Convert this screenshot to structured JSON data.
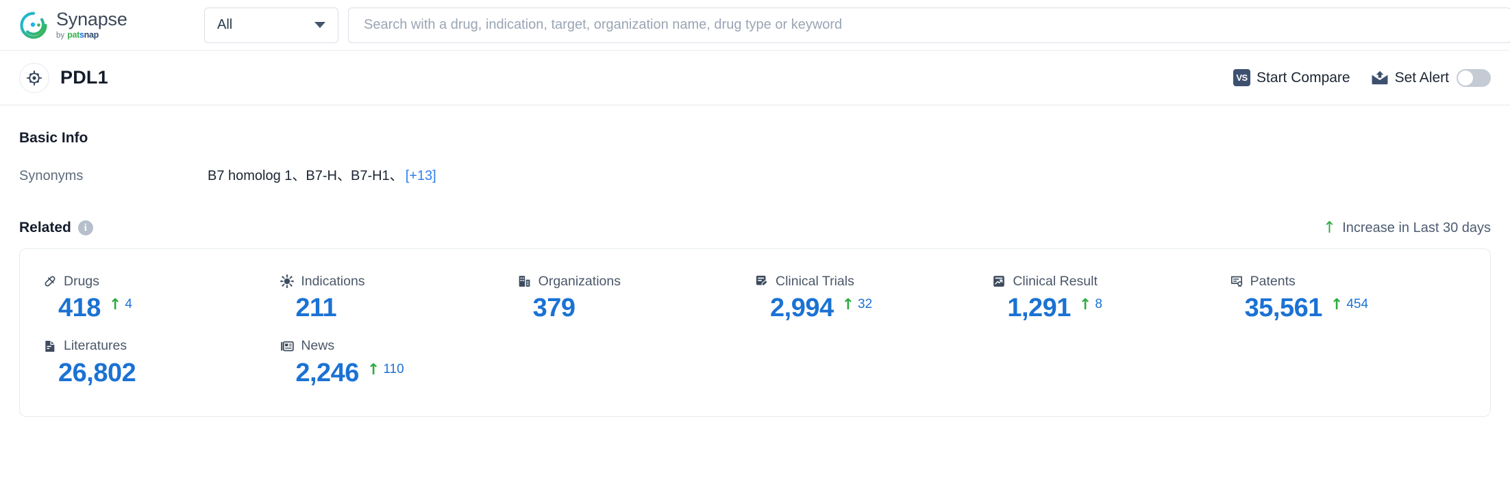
{
  "brand": {
    "name": "Synapse",
    "by": "by",
    "patsnap_pat": "pat",
    "patsnap_s": "s",
    "patsnap_nap": "nap",
    "logo_icon": "synapse-logo-icon",
    "colors": {
      "green": "#38b24a",
      "blue": "#1a73e8",
      "dark": "#2f4b6e"
    }
  },
  "search": {
    "scope_label": "All",
    "scope_icon": "chevron-down-icon",
    "placeholder": "Search with a drug, indication, target, organization name, drug type or keyword",
    "value": ""
  },
  "entity": {
    "icon": "target-icon",
    "title": "PDL1",
    "actions": {
      "compare_label": "Start Compare",
      "compare_icon": "vs-icon",
      "alert_label": "Set Alert",
      "alert_icon": "mail-alert-icon",
      "alert_toggle_on": false
    }
  },
  "basic_info": {
    "heading": "Basic Info",
    "synonyms_label": "Synonyms",
    "synonyms_value": "B7 homolog 1、B7-H、B7-H1、",
    "synonyms_more": "[+13]"
  },
  "related": {
    "heading": "Related",
    "info_icon": "info-icon",
    "info_glyph": "i",
    "legend_icon": "arrow-up-icon",
    "legend_arrow": "↑",
    "legend_text": "Increase in Last 30 days",
    "accent_blue": "#1b72d4",
    "accent_green": "#2cab3f",
    "stats": [
      {
        "label": "Drugs",
        "icon": "pill-icon",
        "value": "418",
        "delta": "4",
        "delta_arrow": "↑",
        "has_delta": true
      },
      {
        "label": "Indications",
        "icon": "virus-icon",
        "value": "211",
        "delta": "",
        "delta_arrow": "",
        "has_delta": false
      },
      {
        "label": "Organizations",
        "icon": "building-icon",
        "value": "379",
        "delta": "",
        "delta_arrow": "",
        "has_delta": false
      },
      {
        "label": "Clinical Trials",
        "icon": "trial-document-icon",
        "value": "2,994",
        "delta": "32",
        "delta_arrow": "↑",
        "has_delta": true
      },
      {
        "label": "Clinical Result",
        "icon": "result-chart-icon",
        "value": "1,291",
        "delta": "8",
        "delta_arrow": "↑",
        "has_delta": true
      },
      {
        "label": "Patents",
        "icon": "patent-seal-icon",
        "value": "35,561",
        "delta": "454",
        "delta_arrow": "↑",
        "has_delta": true
      },
      {
        "label": "Literatures",
        "icon": "literature-icon",
        "value": "26,802",
        "delta": "",
        "delta_arrow": "",
        "has_delta": false
      },
      {
        "label": "News",
        "icon": "news-icon",
        "value": "2,246",
        "delta": "110",
        "delta_arrow": "↑",
        "has_delta": true
      }
    ]
  }
}
